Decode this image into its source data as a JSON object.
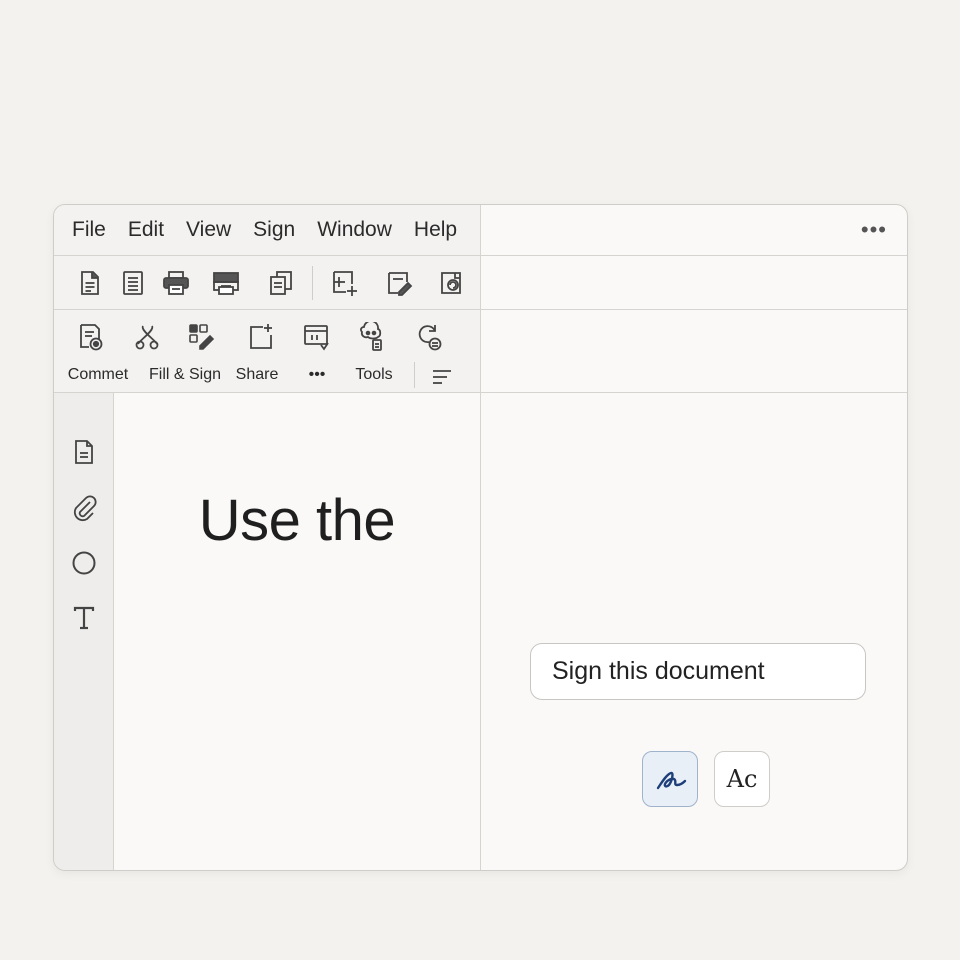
{
  "menu": [
    "File",
    "Edit",
    "View",
    "Sign",
    "Window",
    "Help"
  ],
  "toolbar_icons": [
    "document-icon",
    "page-icon",
    "print-icon",
    "printer-alt-icon",
    "copy-icon",
    "add-frame-icon",
    "edit-note-icon",
    "rotate-icon"
  ],
  "ribbon": {
    "comment_label": "Commet",
    "fill_sign_label": "Fill & Sign",
    "share_label": "Share",
    "more_label": "•••",
    "tools_label": "Tools"
  },
  "sidebar_icons": [
    "file-icon",
    "paperclip-icon",
    "circle-icon",
    "text-tool-icon"
  ],
  "document": {
    "heading": "Use the"
  },
  "right_panel": {
    "more_label": "•••",
    "sign_prompt": "Sign this document",
    "type_signature_label": "Ac"
  },
  "colors": {
    "accent": "#1f3f7a",
    "draw_button_bg": "#e9eff7"
  }
}
